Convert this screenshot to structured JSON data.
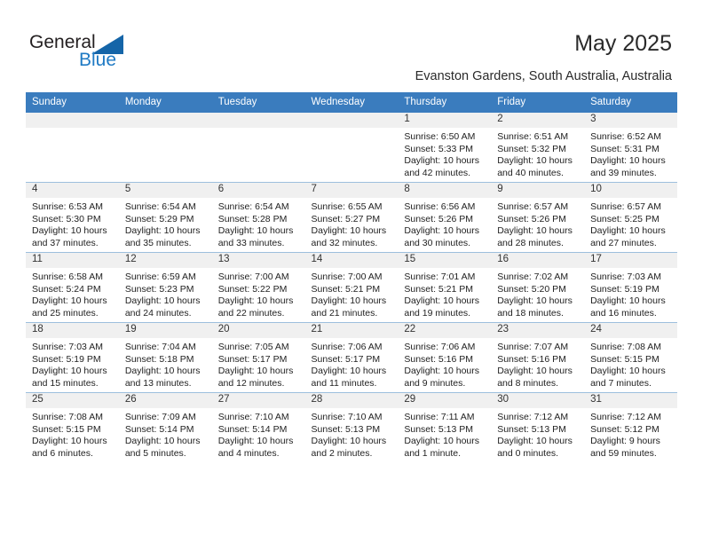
{
  "brand": {
    "name_top": "General",
    "name_bottom": "Blue",
    "accent_color": "#1565a8",
    "text_color": "#231f20"
  },
  "header": {
    "title": "May 2025",
    "location": "Evanston Gardens, South Australia, Australia"
  },
  "calendar": {
    "header_bg": "#3a7cbe",
    "header_text_color": "#ffffff",
    "daynum_bg": "#f0f0f0",
    "weekdays": [
      "Sunday",
      "Monday",
      "Tuesday",
      "Wednesday",
      "Thursday",
      "Friday",
      "Saturday"
    ],
    "labels": {
      "sunrise": "Sunrise:",
      "sunset": "Sunset:",
      "daylight": "Daylight:"
    },
    "weeks": [
      [
        {
          "day": ""
        },
        {
          "day": ""
        },
        {
          "day": ""
        },
        {
          "day": ""
        },
        {
          "day": "1",
          "sunrise": "Sunrise: 6:50 AM",
          "sunset": "Sunset: 5:33 PM",
          "daylight_1": "Daylight: 10 hours",
          "daylight_2": "and 42 minutes."
        },
        {
          "day": "2",
          "sunrise": "Sunrise: 6:51 AM",
          "sunset": "Sunset: 5:32 PM",
          "daylight_1": "Daylight: 10 hours",
          "daylight_2": "and 40 minutes."
        },
        {
          "day": "3",
          "sunrise": "Sunrise: 6:52 AM",
          "sunset": "Sunset: 5:31 PM",
          "daylight_1": "Daylight: 10 hours",
          "daylight_2": "and 39 minutes."
        }
      ],
      [
        {
          "day": "4",
          "sunrise": "Sunrise: 6:53 AM",
          "sunset": "Sunset: 5:30 PM",
          "daylight_1": "Daylight: 10 hours",
          "daylight_2": "and 37 minutes."
        },
        {
          "day": "5",
          "sunrise": "Sunrise: 6:54 AM",
          "sunset": "Sunset: 5:29 PM",
          "daylight_1": "Daylight: 10 hours",
          "daylight_2": "and 35 minutes."
        },
        {
          "day": "6",
          "sunrise": "Sunrise: 6:54 AM",
          "sunset": "Sunset: 5:28 PM",
          "daylight_1": "Daylight: 10 hours",
          "daylight_2": "and 33 minutes."
        },
        {
          "day": "7",
          "sunrise": "Sunrise: 6:55 AM",
          "sunset": "Sunset: 5:27 PM",
          "daylight_1": "Daylight: 10 hours",
          "daylight_2": "and 32 minutes."
        },
        {
          "day": "8",
          "sunrise": "Sunrise: 6:56 AM",
          "sunset": "Sunset: 5:26 PM",
          "daylight_1": "Daylight: 10 hours",
          "daylight_2": "and 30 minutes."
        },
        {
          "day": "9",
          "sunrise": "Sunrise: 6:57 AM",
          "sunset": "Sunset: 5:26 PM",
          "daylight_1": "Daylight: 10 hours",
          "daylight_2": "and 28 minutes."
        },
        {
          "day": "10",
          "sunrise": "Sunrise: 6:57 AM",
          "sunset": "Sunset: 5:25 PM",
          "daylight_1": "Daylight: 10 hours",
          "daylight_2": "and 27 minutes."
        }
      ],
      [
        {
          "day": "11",
          "sunrise": "Sunrise: 6:58 AM",
          "sunset": "Sunset: 5:24 PM",
          "daylight_1": "Daylight: 10 hours",
          "daylight_2": "and 25 minutes."
        },
        {
          "day": "12",
          "sunrise": "Sunrise: 6:59 AM",
          "sunset": "Sunset: 5:23 PM",
          "daylight_1": "Daylight: 10 hours",
          "daylight_2": "and 24 minutes."
        },
        {
          "day": "13",
          "sunrise": "Sunrise: 7:00 AM",
          "sunset": "Sunset: 5:22 PM",
          "daylight_1": "Daylight: 10 hours",
          "daylight_2": "and 22 minutes."
        },
        {
          "day": "14",
          "sunrise": "Sunrise: 7:00 AM",
          "sunset": "Sunset: 5:21 PM",
          "daylight_1": "Daylight: 10 hours",
          "daylight_2": "and 21 minutes."
        },
        {
          "day": "15",
          "sunrise": "Sunrise: 7:01 AM",
          "sunset": "Sunset: 5:21 PM",
          "daylight_1": "Daylight: 10 hours",
          "daylight_2": "and 19 minutes."
        },
        {
          "day": "16",
          "sunrise": "Sunrise: 7:02 AM",
          "sunset": "Sunset: 5:20 PM",
          "daylight_1": "Daylight: 10 hours",
          "daylight_2": "and 18 minutes."
        },
        {
          "day": "17",
          "sunrise": "Sunrise: 7:03 AM",
          "sunset": "Sunset: 5:19 PM",
          "daylight_1": "Daylight: 10 hours",
          "daylight_2": "and 16 minutes."
        }
      ],
      [
        {
          "day": "18",
          "sunrise": "Sunrise: 7:03 AM",
          "sunset": "Sunset: 5:19 PM",
          "daylight_1": "Daylight: 10 hours",
          "daylight_2": "and 15 minutes."
        },
        {
          "day": "19",
          "sunrise": "Sunrise: 7:04 AM",
          "sunset": "Sunset: 5:18 PM",
          "daylight_1": "Daylight: 10 hours",
          "daylight_2": "and 13 minutes."
        },
        {
          "day": "20",
          "sunrise": "Sunrise: 7:05 AM",
          "sunset": "Sunset: 5:17 PM",
          "daylight_1": "Daylight: 10 hours",
          "daylight_2": "and 12 minutes."
        },
        {
          "day": "21",
          "sunrise": "Sunrise: 7:06 AM",
          "sunset": "Sunset: 5:17 PM",
          "daylight_1": "Daylight: 10 hours",
          "daylight_2": "and 11 minutes."
        },
        {
          "day": "22",
          "sunrise": "Sunrise: 7:06 AM",
          "sunset": "Sunset: 5:16 PM",
          "daylight_1": "Daylight: 10 hours",
          "daylight_2": "and 9 minutes."
        },
        {
          "day": "23",
          "sunrise": "Sunrise: 7:07 AM",
          "sunset": "Sunset: 5:16 PM",
          "daylight_1": "Daylight: 10 hours",
          "daylight_2": "and 8 minutes."
        },
        {
          "day": "24",
          "sunrise": "Sunrise: 7:08 AM",
          "sunset": "Sunset: 5:15 PM",
          "daylight_1": "Daylight: 10 hours",
          "daylight_2": "and 7 minutes."
        }
      ],
      [
        {
          "day": "25",
          "sunrise": "Sunrise: 7:08 AM",
          "sunset": "Sunset: 5:15 PM",
          "daylight_1": "Daylight: 10 hours",
          "daylight_2": "and 6 minutes."
        },
        {
          "day": "26",
          "sunrise": "Sunrise: 7:09 AM",
          "sunset": "Sunset: 5:14 PM",
          "daylight_1": "Daylight: 10 hours",
          "daylight_2": "and 5 minutes."
        },
        {
          "day": "27",
          "sunrise": "Sunrise: 7:10 AM",
          "sunset": "Sunset: 5:14 PM",
          "daylight_1": "Daylight: 10 hours",
          "daylight_2": "and 4 minutes."
        },
        {
          "day": "28",
          "sunrise": "Sunrise: 7:10 AM",
          "sunset": "Sunset: 5:13 PM",
          "daylight_1": "Daylight: 10 hours",
          "daylight_2": "and 2 minutes."
        },
        {
          "day": "29",
          "sunrise": "Sunrise: 7:11 AM",
          "sunset": "Sunset: 5:13 PM",
          "daylight_1": "Daylight: 10 hours",
          "daylight_2": "and 1 minute."
        },
        {
          "day": "30",
          "sunrise": "Sunrise: 7:12 AM",
          "sunset": "Sunset: 5:13 PM",
          "daylight_1": "Daylight: 10 hours",
          "daylight_2": "and 0 minutes."
        },
        {
          "day": "31",
          "sunrise": "Sunrise: 7:12 AM",
          "sunset": "Sunset: 5:12 PM",
          "daylight_1": "Daylight: 9 hours",
          "daylight_2": "and 59 minutes."
        }
      ]
    ]
  }
}
